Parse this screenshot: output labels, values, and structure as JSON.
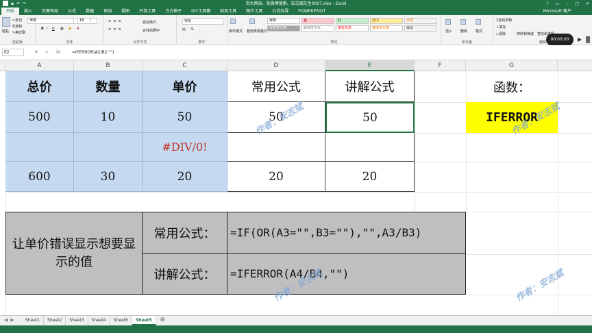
{
  "titlebar": {
    "title": "百大网站、及微博搜索、安志斌先生0007.xlsx - Excel",
    "window_controls": [
      "?",
      "▭",
      "–",
      "▢",
      "✕"
    ]
  },
  "tabs": [
    "开始",
    "插入",
    "页面布局",
    "公式",
    "数据",
    "审阅",
    "视图",
    "开发工具",
    "方方格子",
    "DIY工具箱",
    "财务工具",
    "图片工具",
    "公式向导",
    "POWERPIVOT"
  ],
  "account": "Microsoft 帐户",
  "ribbon": {
    "clipboard": {
      "cut": "剪切",
      "copy": "复制",
      "format_painter": "格式刷",
      "paste": "粘贴",
      "label": "剪贴板"
    },
    "font": {
      "name": "宋体",
      "size": "18",
      "bold": "B",
      "italic": "I",
      "underline": "U",
      "label": "字体"
    },
    "alignment": {
      "wrap": "自动换行",
      "merge": "合并后居中",
      "label": "对齐方式"
    },
    "number": {
      "format": "常规",
      "label": "数字"
    },
    "styles": {
      "cond_format": "条件格式",
      "table_format": "套用表格格式",
      "cells": [
        {
          "label": "常规",
          "bg": "#ffffff",
          "color": "#000000"
        },
        {
          "label": "差",
          "bg": "#ffc7ce",
          "color": "#9c0006"
        },
        {
          "label": "好",
          "bg": "#c6efce",
          "color": "#006100"
        },
        {
          "label": "适中",
          "bg": "#ffeb9c",
          "color": "#9c5700"
        },
        {
          "label": "计算",
          "bg": "#f2f2f2",
          "color": "#fa7d00"
        },
        {
          "label": "检查单元格",
          "bg": "#a5a5a5",
          "color": "#ffffff"
        },
        {
          "label": "解释性文本",
          "bg": "#ffffff",
          "color": "#7f7f7f"
        },
        {
          "label": "警告文本",
          "bg": "#ffffff",
          "color": "#ff0000"
        },
        {
          "label": "链接单元格",
          "bg": "#ffffff",
          "color": "#fa7d00"
        },
        {
          "label": "输出",
          "bg": "#f2f2f2",
          "color": "#3f3f3f"
        }
      ],
      "label": "样式"
    },
    "cells_group": {
      "insert": "插入",
      "delete": "删除",
      "format": "格式",
      "label": "单元格"
    },
    "editing": {
      "autosum": "自动求和",
      "fill": "填充",
      "clear": "清除",
      "sort": "排序和筛选",
      "find": "查找和选择",
      "label": "编辑"
    }
  },
  "video_time": "00:00:00",
  "formula_bar": {
    "name_box": "E2",
    "formula": "=IFERROR(A2/B2,\"\")"
  },
  "columns": [
    "A",
    "B",
    "C",
    "D",
    "E",
    "F",
    "G"
  ],
  "table": {
    "headers": [
      "总价",
      "数量",
      "单价",
      "常用公式",
      "讲解公式"
    ],
    "rows": [
      [
        "500",
        "10",
        "50",
        "50",
        "50"
      ],
      [
        "",
        "",
        "#DIV/0!",
        "",
        ""
      ],
      [
        "600",
        "30",
        "20",
        "20",
        "20"
      ]
    ]
  },
  "function_box": {
    "label": "函数：",
    "name": "IFERROR",
    "color": "#ffff00"
  },
  "explain": {
    "left": "让单价错误显示想要显示的值",
    "row1_label": "常用公式：",
    "row1_formula": "=IF(OR(A3=\"\",B3=\"\"),\"\",A3/B3)",
    "row2_label": "讲解公式：",
    "row2_formula": "=IFERROR(A4/B4,\"\")"
  },
  "watermark": "作者：安志斌",
  "sheets": [
    "Sheet1",
    "Sheet2",
    "Sheet3",
    "Sheet4",
    "Sheet6",
    "Sheet5"
  ],
  "active_sheet": "Sheet5",
  "colors": {
    "excel_green": "#217346",
    "blue_fill": "#c5d9f1",
    "gray_fill": "#bfbfbf"
  }
}
